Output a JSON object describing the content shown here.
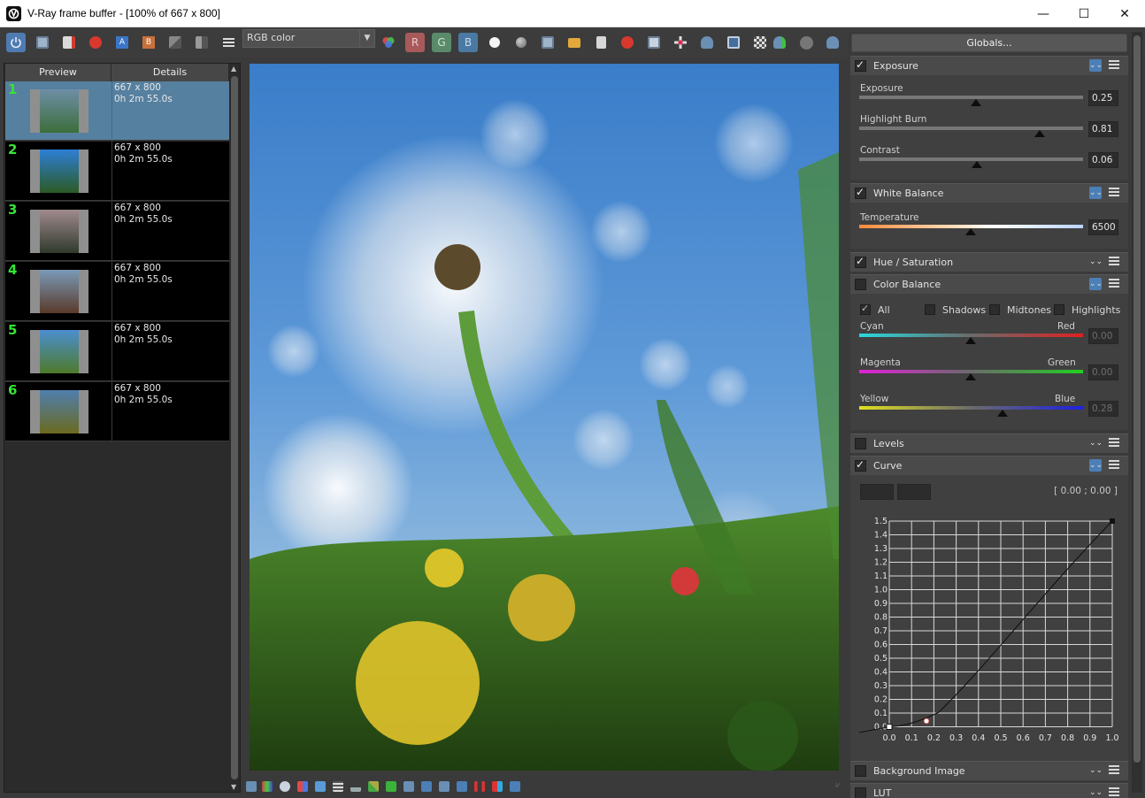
{
  "window": {
    "title": "V-Ray frame buffer - [100% of 667 x 800]",
    "minimize": "—",
    "maximize": "☐",
    "close": "✕"
  },
  "toolbar": {
    "channel_dropdown": "RGB color",
    "channel_r": "R",
    "channel_g": "G",
    "channel_b": "B",
    "compare_a": "A",
    "compare_b": "B"
  },
  "history": {
    "columns": [
      "Preview",
      "Details"
    ],
    "rows": [
      {
        "num": "1",
        "size": "667 x 800",
        "time": "0h 2m 55.0s",
        "tint": "#6e8ea6"
      },
      {
        "num": "2",
        "size": "667 x 800",
        "time": "0h 2m 55.0s",
        "tint": "#2d7fd6"
      },
      {
        "num": "3",
        "size": "667 x 800",
        "time": "0h 2m 55.0s",
        "tint": "#a08a8e"
      },
      {
        "num": "4",
        "size": "667 x 800",
        "time": "0h 2m 55.0s",
        "tint": "#7a9ab8"
      },
      {
        "num": "5",
        "size": "667 x 800",
        "time": "0h 2m 55.0s",
        "tint": "#4b8fd0"
      },
      {
        "num": "6",
        "size": "667 x 800",
        "time": "0h 2m 55.0s",
        "tint": "#4f7fae"
      }
    ]
  },
  "panel": {
    "globals_label": "Globals...",
    "exposure": {
      "title": "Exposure",
      "exposure_label": "Exposure",
      "exposure_value": "0.25",
      "highlight_label": "Highlight Burn",
      "highlight_value": "0.81",
      "contrast_label": "Contrast",
      "contrast_value": "0.06"
    },
    "white_balance": {
      "title": "White Balance",
      "temperature_label": "Temperature",
      "temperature_value": "6500"
    },
    "hue_saturation": {
      "title": "Hue / Saturation"
    },
    "color_balance": {
      "title": "Color Balance",
      "all": "All",
      "shadows": "Shadows",
      "midtones": "Midtones",
      "highlights": "Highlights",
      "cyan": "Cyan",
      "red": "Red",
      "cyan_red_value": "0.00",
      "magenta": "Magenta",
      "green": "Green",
      "magenta_green_value": "0.00",
      "yellow": "Yellow",
      "blue": "Blue",
      "yellow_blue_value": "0.28"
    },
    "levels": {
      "title": "Levels"
    },
    "curve": {
      "title": "Curve",
      "coords": "[ 0.00 ; 0.00 ]",
      "y_ticks": [
        "1.5",
        "1.4",
        "1.3",
        "1.2",
        "1.1",
        "1.0",
        "0.9",
        "0.8",
        "0.7",
        "0.6",
        "0.5",
        "0.4",
        "0.3",
        "0.2",
        "0.1",
        "0.0"
      ],
      "x_ticks": [
        "0.0",
        "0.1",
        "0.2",
        "0.3",
        "0.4",
        "0.5",
        "0.6",
        "0.7",
        "0.8",
        "0.9",
        "1.0"
      ]
    },
    "background_image": {
      "title": "Background Image"
    },
    "lut": {
      "title": "LUT"
    }
  },
  "colors": {
    "accent": "#4f7bb3",
    "history_number": "#35e535",
    "selected_row": "#56809f"
  }
}
